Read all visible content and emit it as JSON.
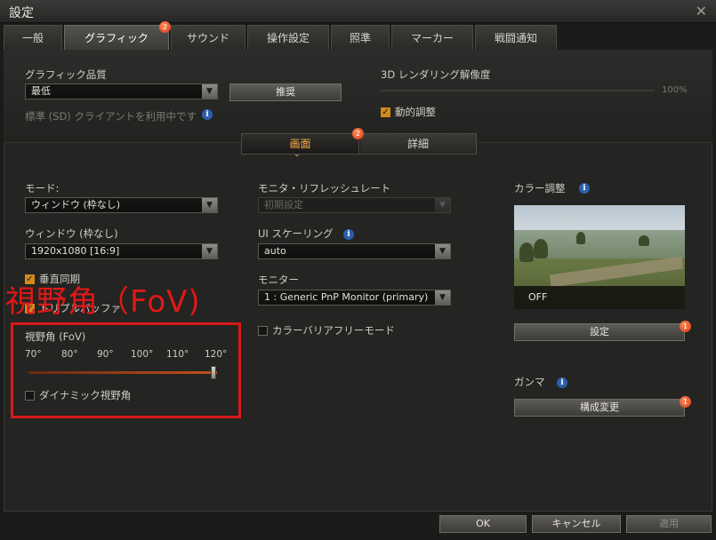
{
  "window": {
    "title": "設定",
    "close_glyph": "✕"
  },
  "tabs": [
    {
      "label": "一般"
    },
    {
      "label": "グラフィック",
      "badge": "2"
    },
    {
      "label": "サウンド"
    },
    {
      "label": "操作設定"
    },
    {
      "label": "照準"
    },
    {
      "label": "マーカー"
    },
    {
      "label": "戦闘通知"
    }
  ],
  "graphics_quality": {
    "label": "グラフィック品質",
    "value": "最低",
    "recommend_button": "推奨",
    "sd_client_note": "標準 (SD) クライアントを利用中です"
  },
  "render_resolution": {
    "label": "3D レンダリング解像度",
    "value": "100%",
    "dynamic_label": "動的調整",
    "dynamic_checked": true
  },
  "segment": {
    "screen_label": "画面",
    "screen_badge": "2",
    "detail_label": "詳細"
  },
  "mode": {
    "label": "モード:",
    "value": "ウィンドウ (枠なし)"
  },
  "window_size": {
    "label": "ウィンドウ (枠なし)",
    "value": "1920x1080 [16:9]"
  },
  "vsync": {
    "label": "垂直同期",
    "checked": true
  },
  "triple_buffer": {
    "label": "トリプルバッファ",
    "checked": true
  },
  "fov": {
    "overlay_text": "視野角（FoV)",
    "label": "視野角 (FoV)",
    "ticks": [
      "70°",
      "80°",
      "90°",
      "100°",
      "110°",
      "120°"
    ],
    "value_fraction": 1.0,
    "dynamic_label": "ダイナミック視野角",
    "dynamic_checked": false
  },
  "refresh_rate": {
    "label": "モニタ・リフレッシュレート",
    "value": "初期設定",
    "disabled": true
  },
  "ui_scaling": {
    "label": "UI スケーリング",
    "value": "auto"
  },
  "monitor": {
    "label": "モニター",
    "value": "1 : Generic PnP Monitor (primary)"
  },
  "colorblind": {
    "label": "カラーバリアフリーモード",
    "checked": false
  },
  "color_adjust": {
    "label": "カラー調整",
    "preview_status": "OFF",
    "button": "設定",
    "badge": "1"
  },
  "gamma": {
    "label": "ガンマ",
    "button": "構成変更",
    "badge": "1"
  },
  "footer": {
    "ok": "OK",
    "cancel": "キャンセル",
    "apply": "適用"
  },
  "icons": {
    "info": "info-icon",
    "dropdown": "chevron-down-icon",
    "check": "check-icon"
  },
  "colors": {
    "accent": "#ffb347",
    "badge": "#e0481a",
    "annotation": "#e01818",
    "info": "#2b5fae"
  }
}
